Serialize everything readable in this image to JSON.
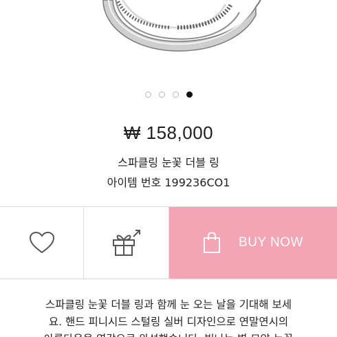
{
  "carousel": {
    "count": 4,
    "active_index": 3
  },
  "product": {
    "price": "₩ 158,000",
    "name": "스파클링 눈꽃 더블 링",
    "item_number": "아이템 번호 199236CO1"
  },
  "actions": {
    "wishlist_icon": "heart-icon",
    "gift_icon": "gift-icon",
    "buy_icon": "shopping-bag-icon",
    "buy_label": "BUY NOW",
    "buy_color": "#f3a5b5"
  },
  "description": {
    "lines": [
      "스파클링 눈꽃 더블 링과 함께 눈 오는 날을 기대해 보세",
      "요. 핸드 피니시드 스털링 실버 디자인으로 연말연시의",
      "아름다움을 영감으로 완성했습니다. 빛나는 별 모양 눈꽃"
    ]
  }
}
